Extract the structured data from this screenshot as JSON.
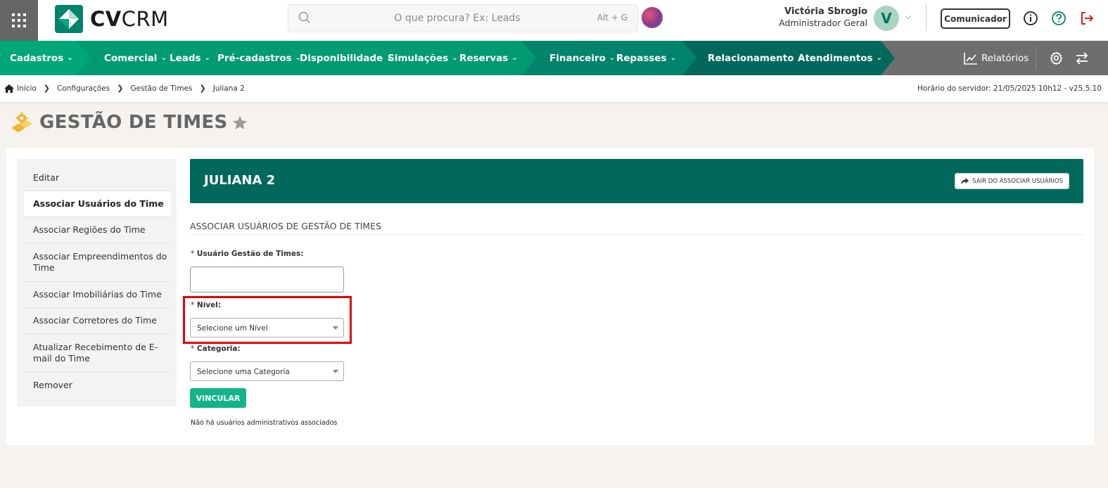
{
  "header": {
    "logo_text_bold": "CV",
    "logo_text_rest": "CRM",
    "search_placeholder": "O que procura? Ex: Leads",
    "search_shortcut": "Alt + G",
    "user_name": "Victória Sbrogio",
    "user_role": "Administrador Geral",
    "avatar_letter": "V",
    "comunicador_label": "Comunicador"
  },
  "colors": {
    "nav_green_1": "#00a878",
    "nav_green_2": "#009a73",
    "nav_green_3": "#00846b",
    "nav_green_4": "#00695c",
    "nav_gray": "#6e6e6e",
    "form_header": "#00695c",
    "vincular_button": "#14b48a",
    "highlight": "#e00000"
  },
  "nav": {
    "items": [
      {
        "label": "Cadastros"
      },
      {
        "label": "Comercial"
      },
      {
        "label": "Leads"
      },
      {
        "label": "Pré-cadastros"
      },
      {
        "label": "Disponibilidade"
      },
      {
        "label": "Simulações"
      },
      {
        "label": "Reservas"
      },
      {
        "label": "Financeiro"
      },
      {
        "label": "Repasses"
      },
      {
        "label": "Relacionamento"
      },
      {
        "label": "Atendimentos"
      }
    ],
    "reports_label": "Relatórios"
  },
  "breadcrumb": {
    "items": [
      "Início",
      "Configurações",
      "Gestão de Times",
      "Juliana 2"
    ],
    "server_time": "Horário do servidor: 21/05/2025 10h12 - v25.5.10"
  },
  "page": {
    "title": "GESTÃO DE TIMES"
  },
  "side_menu": {
    "items": [
      {
        "label": "Editar"
      },
      {
        "label": "Associar Usuários do Time"
      },
      {
        "label": "Associar Regiões do Time"
      },
      {
        "label": "Associar Empreendimentos do Time"
      },
      {
        "label": "Associar Imobiliárias do Time"
      },
      {
        "label": "Associar Corretores do Time"
      },
      {
        "label": "Atualizar Recebimento de E-mail do Time"
      },
      {
        "label": "Remover"
      }
    ]
  },
  "form": {
    "header_title": "JULIANA 2",
    "exit_label": "SAIR DO ASSOCIAR USUÁRIOS",
    "section_title": "ASSOCIAR USUÁRIOS DE GESTÃO DE TIMES",
    "required_mark": "*",
    "user_label": "Usuário Gestão de Times:",
    "user_value": "",
    "level_label": "Nível:",
    "level_value": "Selecione um Nível",
    "category_label": "Categoria:",
    "category_value": "Selecione uma Categoria",
    "submit_label": "VINCULAR",
    "empty_message": "Não há usuários administrativos associados"
  }
}
